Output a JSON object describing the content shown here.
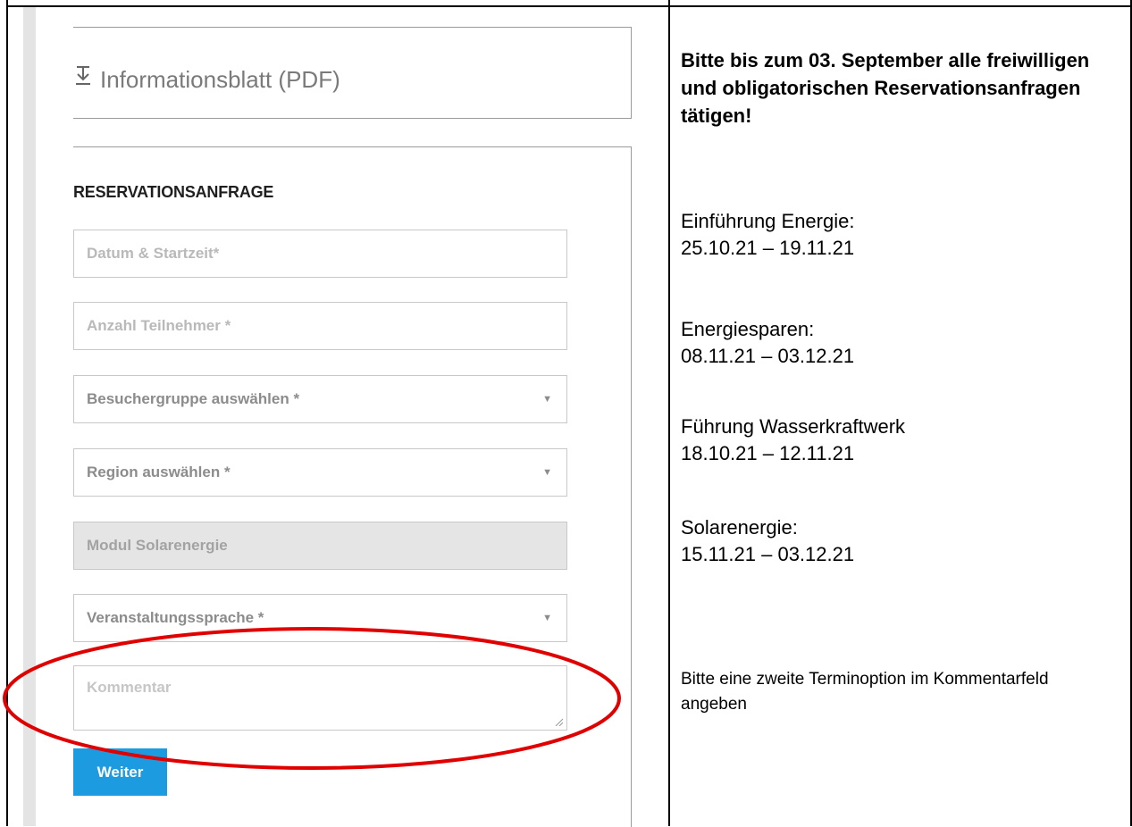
{
  "left": {
    "info_link": {
      "icon": "download-icon",
      "label": "Informationsblatt (PDF)"
    },
    "form": {
      "title": "RESERVATIONSANFRAGE",
      "fields": {
        "date": {
          "placeholder": "Datum & Startzeit*"
        },
        "participants": {
          "placeholder": "Anzahl Teilnehmer *"
        },
        "visitor_group": {
          "placeholder": "Besuchergruppe auswählen *"
        },
        "region": {
          "placeholder": "Region auswählen *"
        },
        "module": {
          "value": "Modul Solarenergie"
        },
        "language": {
          "placeholder": "Veranstaltungssprache *"
        },
        "comment": {
          "placeholder": "Kommentar"
        }
      },
      "submit_label": "Weiter"
    },
    "highlight_color": "#e00000"
  },
  "right": {
    "headline": "Bitte bis zum 03. September alle freiwilligen und obligatorischen Reservationsanfragen tätigen!",
    "entries": [
      {
        "title": "Einführung Energie:",
        "dates": "25.10.21 – 19.11.21"
      },
      {
        "title": "Energiesparen:",
        "dates": "08.11.21 – 03.12.21"
      },
      {
        "title": "Führung Wasserkraftwerk",
        "dates": "18.10.21 – 12.11.21"
      },
      {
        "title": "Solarenergie:",
        "dates": "15.11.21 – 03.12.21"
      }
    ],
    "note": "Bitte eine zweite Terminoption im Kommentarfeld angeben"
  }
}
